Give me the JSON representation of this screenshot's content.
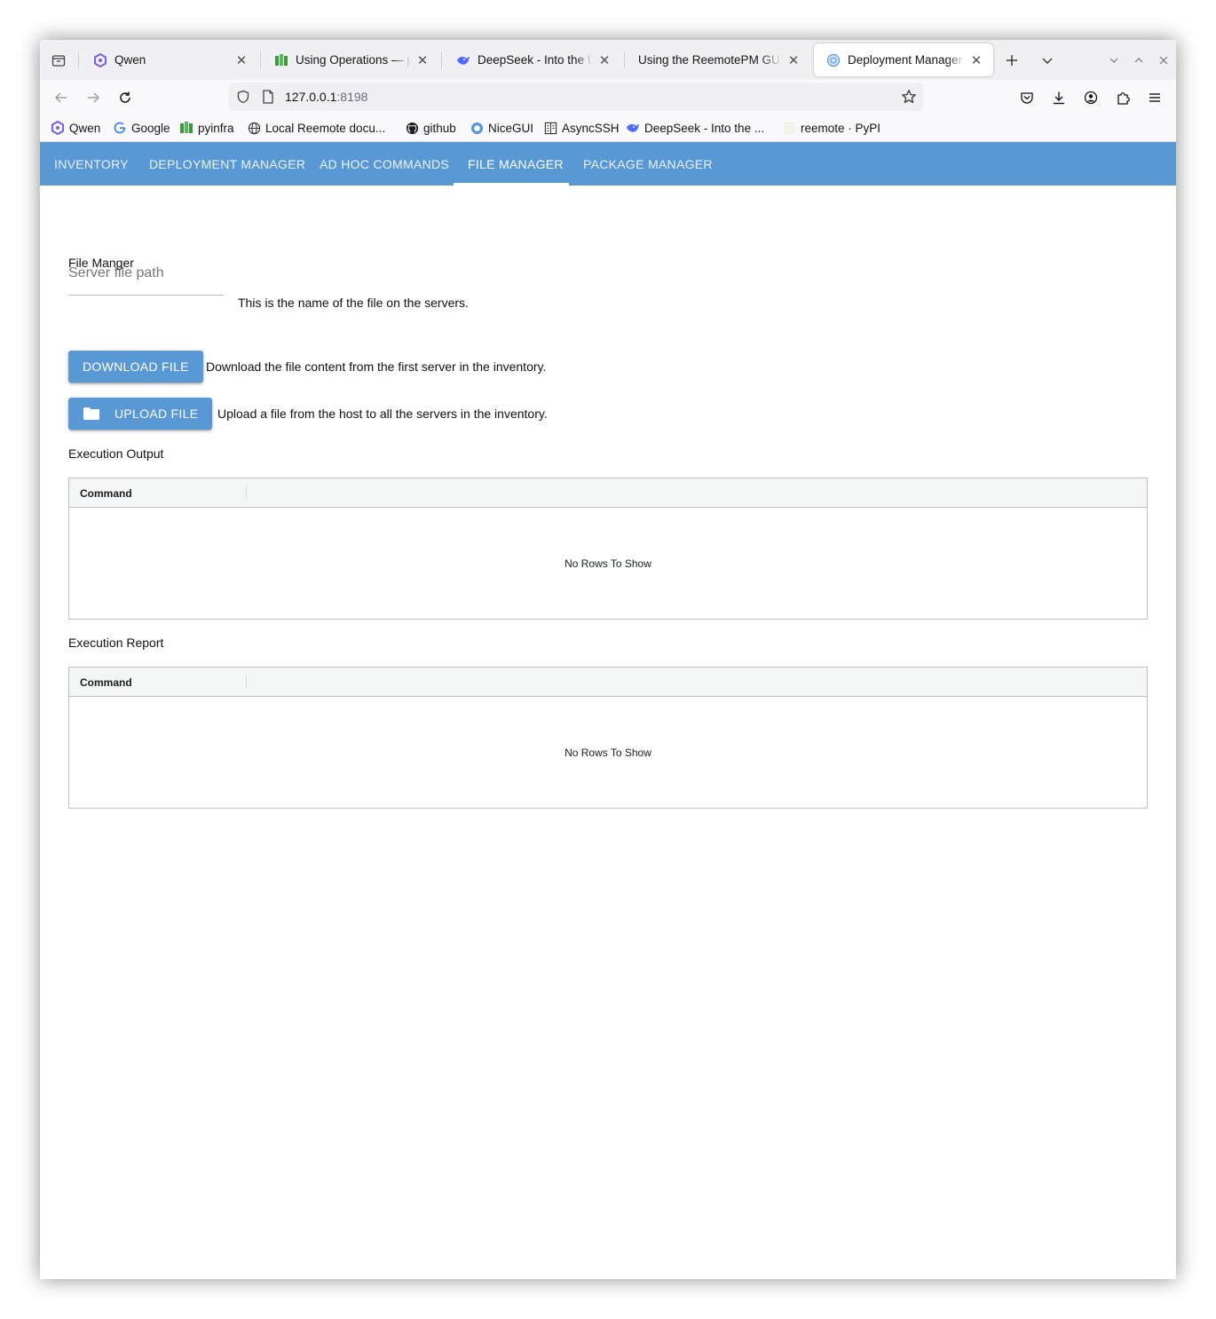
{
  "browser": {
    "tabs": [
      {
        "title": "Qwen",
        "icon": "qwen-icon"
      },
      {
        "title": "Using Operations — pyinfra",
        "icon": "pyinfra-icon"
      },
      {
        "title": "DeepSeek - Into the Unknown",
        "icon": "deepseek-icon"
      },
      {
        "title": "Using the ReemotePM GUI",
        "icon": "none"
      },
      {
        "title": "Deployment Manager",
        "icon": "globe-icon",
        "active": true
      }
    ],
    "url": {
      "host": "127.0.0.1",
      "port": ":8198"
    },
    "bookmarks": [
      {
        "label": "Qwen",
        "icon": "qwen-icon"
      },
      {
        "label": "Google",
        "icon": "google-icon"
      },
      {
        "label": "pyinfra",
        "icon": "pyinfra-icon"
      },
      {
        "label": "Local Reemote docu...",
        "icon": "globe-icon"
      },
      {
        "label": "github",
        "icon": "github-icon"
      },
      {
        "label": "NiceGUI",
        "icon": "nicegui-icon"
      },
      {
        "label": "AsyncSSH",
        "icon": "asyncssh-icon"
      },
      {
        "label": "DeepSeek - Into the ...",
        "icon": "deepseek-icon"
      },
      {
        "label": "reemote · PyPI",
        "icon": "pypi-icon"
      }
    ]
  },
  "app": {
    "nav_tabs": [
      {
        "label": "Inventory"
      },
      {
        "label": "Deployment Manager"
      },
      {
        "label": "Ad Hoc Commands"
      },
      {
        "label": "File Manager",
        "active": true
      },
      {
        "label": "Package Manager"
      }
    ],
    "accent_color": "#5898d4"
  },
  "file_manager": {
    "title": "File Manger",
    "path_input": {
      "placeholder": "Server file path",
      "value": ""
    },
    "path_hint": "This is the name of the file on the servers.",
    "download_button": "Download file",
    "download_hint": "Download the file content from the first server in the inventory.",
    "upload_button": "Upload file",
    "upload_icon": "folder-icon",
    "upload_hint": "Upload a file from the host to all the servers in the inventory."
  },
  "output": {
    "title": "Execution Output",
    "column": "Command",
    "empty": "No Rows To Show"
  },
  "report": {
    "title": "Execution Report",
    "column": "Command",
    "empty": "No Rows To Show"
  }
}
